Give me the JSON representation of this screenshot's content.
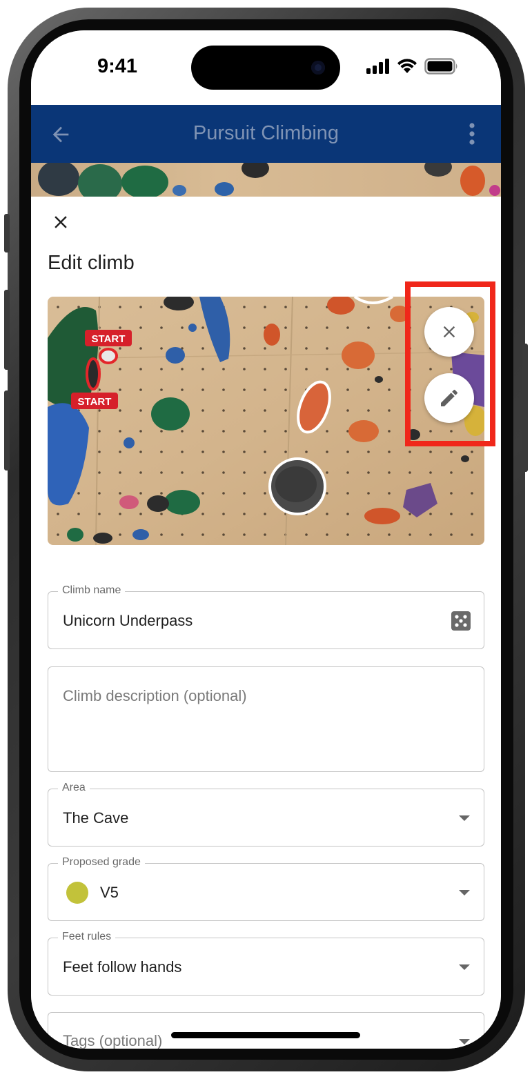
{
  "status_bar": {
    "time": "9:41",
    "icons": [
      "signal-icon",
      "wifi-icon",
      "battery-icon"
    ]
  },
  "app_bar": {
    "title": "Pursuit Climbing",
    "back_icon": "arrow-back-icon",
    "menu_icon": "more-vert-icon",
    "background_color": "#0a3677"
  },
  "sheet": {
    "close_icon": "close-icon",
    "title": "Edit climb",
    "photo": {
      "start_labels": [
        "START",
        "START"
      ],
      "actions": [
        {
          "icon": "close-icon",
          "name": "remove-photo-button"
        },
        {
          "icon": "edit-pencil-icon",
          "name": "edit-photo-button"
        }
      ],
      "highlight_color": "#f0271a"
    },
    "form": {
      "climb_name": {
        "label": "Climb name",
        "value": "Unicorn Underpass",
        "icon": "dice-icon"
      },
      "description": {
        "placeholder": "Climb description (optional)"
      },
      "area": {
        "label": "Area",
        "value": "The Cave"
      },
      "grade": {
        "label": "Proposed grade",
        "value": "V5",
        "color": "#c2c23a"
      },
      "feet_rules": {
        "label": "Feet rules",
        "value": "Feet follow hands"
      },
      "tags": {
        "placeholder": "Tags (optional)"
      }
    }
  }
}
